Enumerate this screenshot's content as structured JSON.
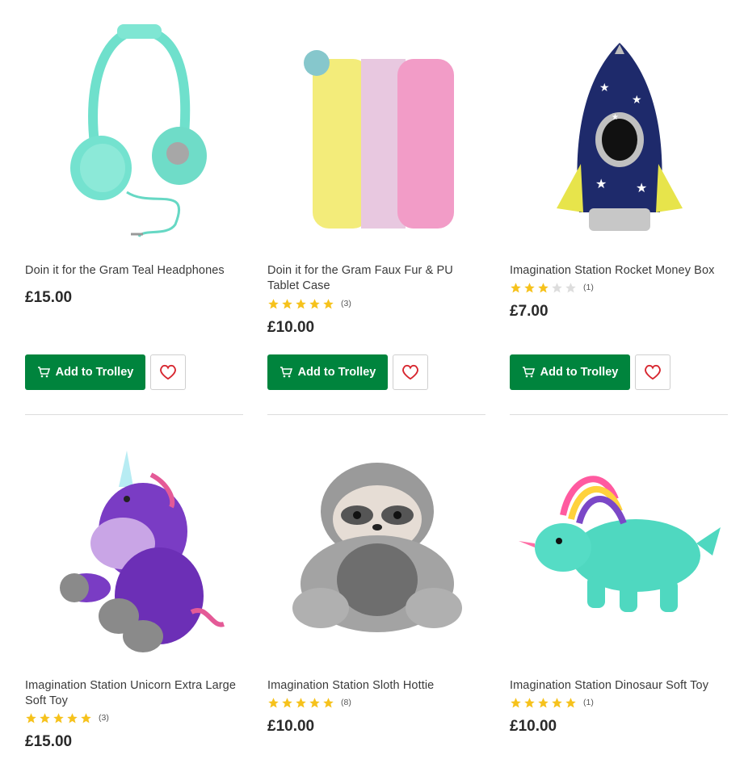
{
  "colors": {
    "primary": "#00843d",
    "star_filled": "#f6c21c",
    "star_empty": "#dddddd",
    "heart": "#d7262f"
  },
  "products": [
    {
      "title": "Doin it for the Gram Teal Headphones",
      "price": "£15.00",
      "rating_count": null,
      "stars": null,
      "add_label": "Add to Trolley",
      "image": "teal-headphones"
    },
    {
      "title": "Doin it for the Gram Faux Fur & PU Tablet Case",
      "price": "£10.00",
      "rating_count": "(3)",
      "stars": 5,
      "add_label": "Add to Trolley",
      "image": "faux-fur-tablet-case"
    },
    {
      "title": "Imagination Station Rocket Money Box",
      "price": "£7.00",
      "rating_count": "(1)",
      "stars": 3,
      "add_label": "Add to Trolley",
      "image": "rocket-money-box"
    },
    {
      "title": "Imagination Station Unicorn Extra Large Soft Toy",
      "price": "£15.00",
      "rating_count": "(3)",
      "stars": 5,
      "image": "unicorn-soft-toy"
    },
    {
      "title": "Imagination Station Sloth Hottie",
      "price": "£10.00",
      "rating_count": "(8)",
      "stars": 5,
      "image": "sloth-hottie"
    },
    {
      "title": "Imagination Station Dinosaur Soft Toy",
      "price": "£10.00",
      "rating_count": "(1)",
      "stars": 5,
      "image": "dinosaur-soft-toy"
    }
  ]
}
